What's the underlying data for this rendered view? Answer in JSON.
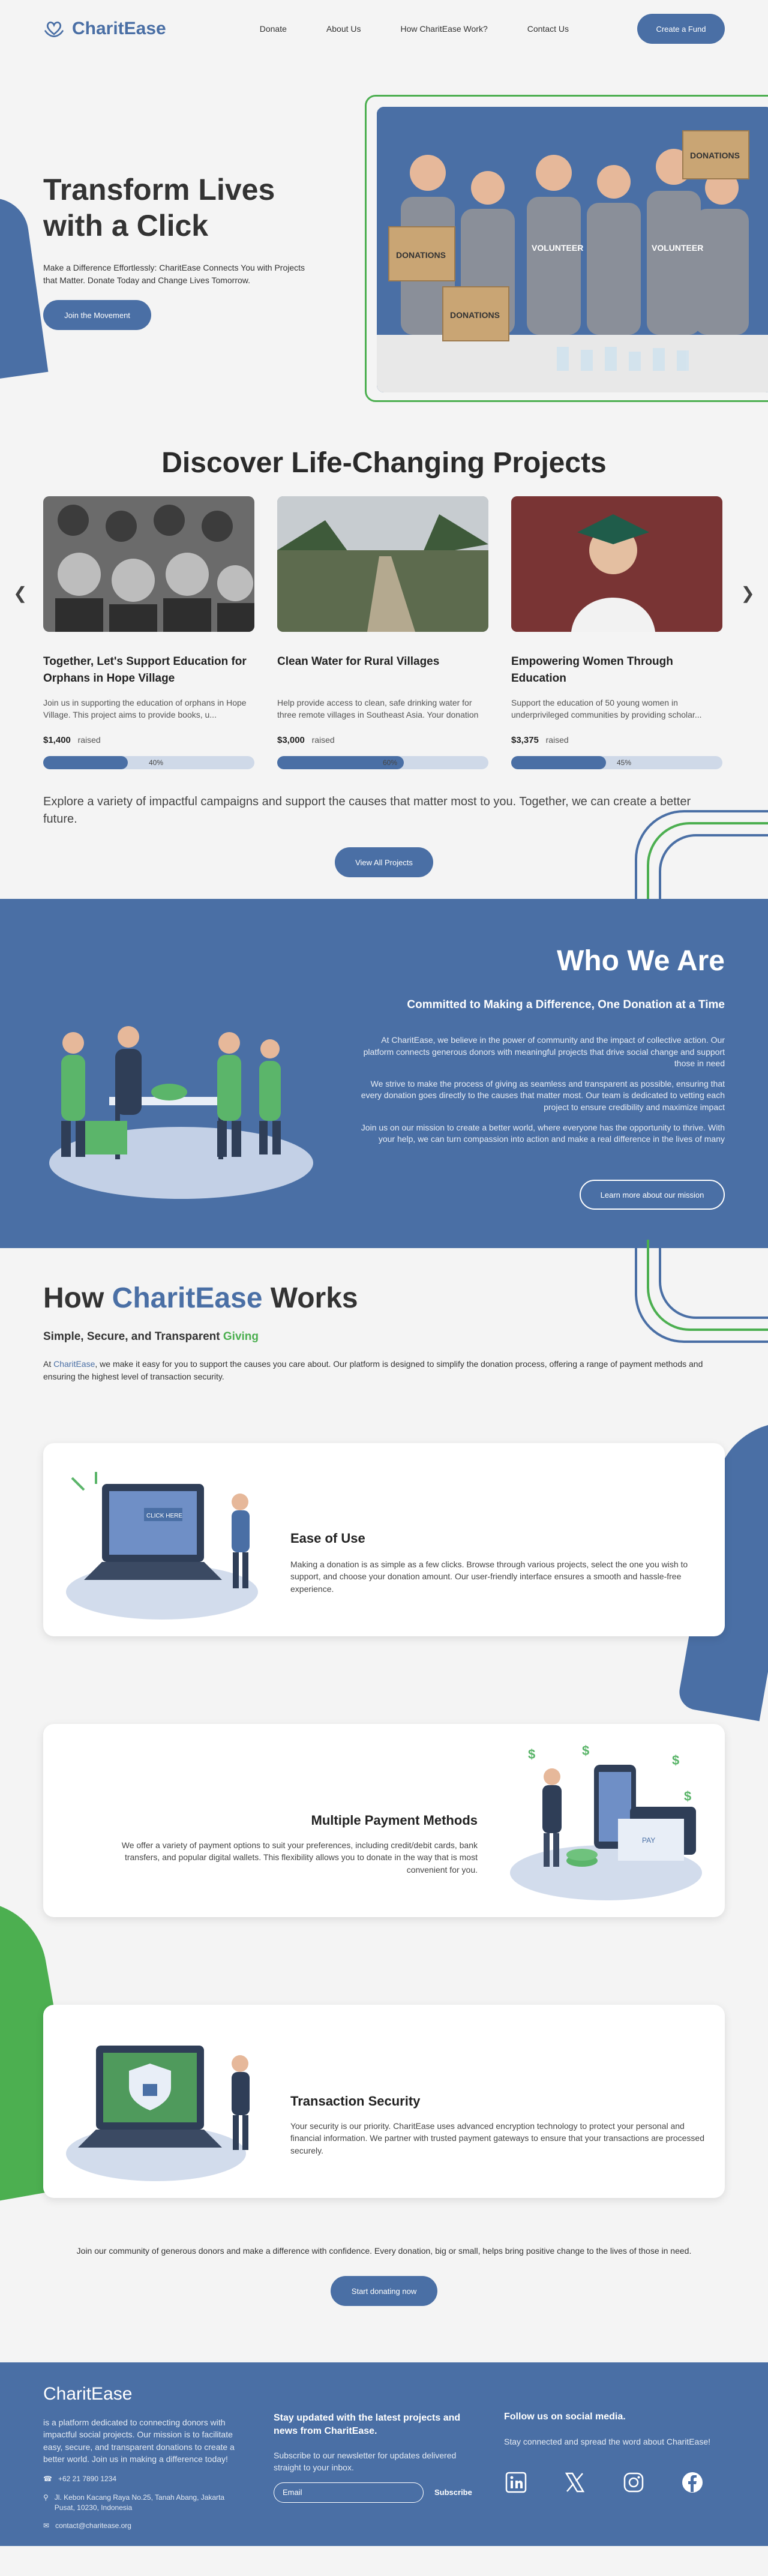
{
  "brand": {
    "name": "CharitEase"
  },
  "nav": {
    "links": [
      "Donate",
      "About Us",
      "How CharitEase Work?",
      "Contact Us"
    ],
    "cta": "Create a Fund"
  },
  "hero": {
    "title": "Transform Lives with a Click",
    "subtitle": "Make a Difference Effortlessly: CharitEase Connects You with Projects that Matter. Donate Today and Change Lives Tomorrow.",
    "button": "Join the Movement",
    "image_labels": [
      "DONATIONS",
      "DONATIONS",
      "DONATIONS",
      "VOLUNTEER",
      "VOLUNTEER"
    ]
  },
  "projects": {
    "title": "Discover Life-Changing Projects",
    "cards": [
      {
        "title": "Together, Let's Support Education for Orphans in Hope Village",
        "desc": "Join us in supporting the education of orphans in Hope Village. This project aims to provide books, u...",
        "amount": "$1,400",
        "raised_label": "raised",
        "percent_label": "40%",
        "percent": 40
      },
      {
        "title": "Clean Water for Rural Villages",
        "desc": "Help provide access to clean, safe drinking water for three remote villages in Southeast Asia. Your donation will fund the construction of wells and wa...",
        "amount": "$3,000",
        "raised_label": "raised",
        "percent_label": "60%",
        "percent": 60
      },
      {
        "title": "Empowering Women Through Education",
        "desc": "Support the education of 50 young women in underprivileged communities by providing scholar...",
        "amount": "$3,375",
        "raised_label": "raised",
        "percent_label": "45%",
        "percent": 45
      }
    ],
    "note": "Explore a variety of impactful campaigns and support the causes that matter most to you. Together, we can create a better future.",
    "button": "View All Projects"
  },
  "who": {
    "title": "Who We Are",
    "subtitle": "Committed to Making a Difference, One Donation at a Time",
    "paragraphs": [
      "At CharitEase, we believe in the power of community and the impact of collective action. Our platform connects generous donors with meaningful projects that drive social change and support those in need",
      "We strive to make the process of giving as seamless and transparent as possible, ensuring that every donation goes directly to the causes that matter most. Our team is dedicated to vetting each project to ensure credibility and maximize impact",
      "Join us on our mission to create a better world, where everyone has the opportunity to thrive. With your help, we can turn compassion into action and make a real difference in the lives of many"
    ],
    "button": "Learn more about our mission"
  },
  "how": {
    "title_prefix": "How",
    "title_brand": "CharitEase",
    "title_suffix": "Works",
    "subtitle_main": "Simple, Secure, and Transparent",
    "subtitle_green": "Giving",
    "intro_prefix": "At",
    "intro_brand": "CharitEase",
    "intro_rest": ", we make it easy for you to support the causes you care about. Our platform is designed to simplify the donation process, offering a range of payment methods and ensuring the highest level of transaction security.",
    "features": [
      {
        "title": "Ease of Use",
        "text": "Making a donation is as simple as a few clicks. Browse through various projects, select the one you wish to support, and choose your donation amount. Our user-friendly interface ensures a smooth and hassle-free experience.",
        "image_label": "CLICK HERE"
      },
      {
        "title": "Multiple Payment Methods",
        "text": "We offer a variety of payment options to suit your preferences, including credit/debit cards, bank transfers, and popular digital wallets. This flexibility allows you to donate in the way that is most convenient for you.",
        "image_label": "PAY"
      },
      {
        "title": "Transaction Security",
        "text": "Your security is our priority. CharitEase uses advanced encryption technology to protect your personal and financial information. We partner with trusted payment gateways to ensure that your transactions are processed securely."
      }
    ],
    "join_text": "Join our community of generous donors and make a difference with confidence. Every donation, big or small, helps bring positive change to the lives of those in need.",
    "join_button": "Start donating now"
  },
  "footer": {
    "brand": "CharitEase",
    "about": "is a platform dedicated to connecting donors with impactful social projects. Our mission is to facilitate easy, secure, and transparent donations to create a better world. Join us in making a difference today!",
    "phone": "+62 21 7890 1234",
    "address": "Jl. Kebon Kacang Raya No.25, Tanah Abang, Jakarta Pusat, 10230, Indonesia",
    "email": "contact@charitease.org",
    "newsletter_title": "Stay updated with the latest projects and news from CharitEase.",
    "newsletter_text": "Subscribe to our newsletter for updates delivered straight to your inbox.",
    "email_placeholder": "Email",
    "subscribe": "Subscribe",
    "social_title": "Follow us on social media.",
    "social_text": "Stay connected and spread the word about CharitEase!",
    "social_icons": [
      "linkedin-icon",
      "x-icon",
      "instagram-icon",
      "facebook-icon"
    ]
  },
  "colors": {
    "primary": "#4a6fa5",
    "accent": "#4caf50",
    "background": "#f4f4f4"
  }
}
